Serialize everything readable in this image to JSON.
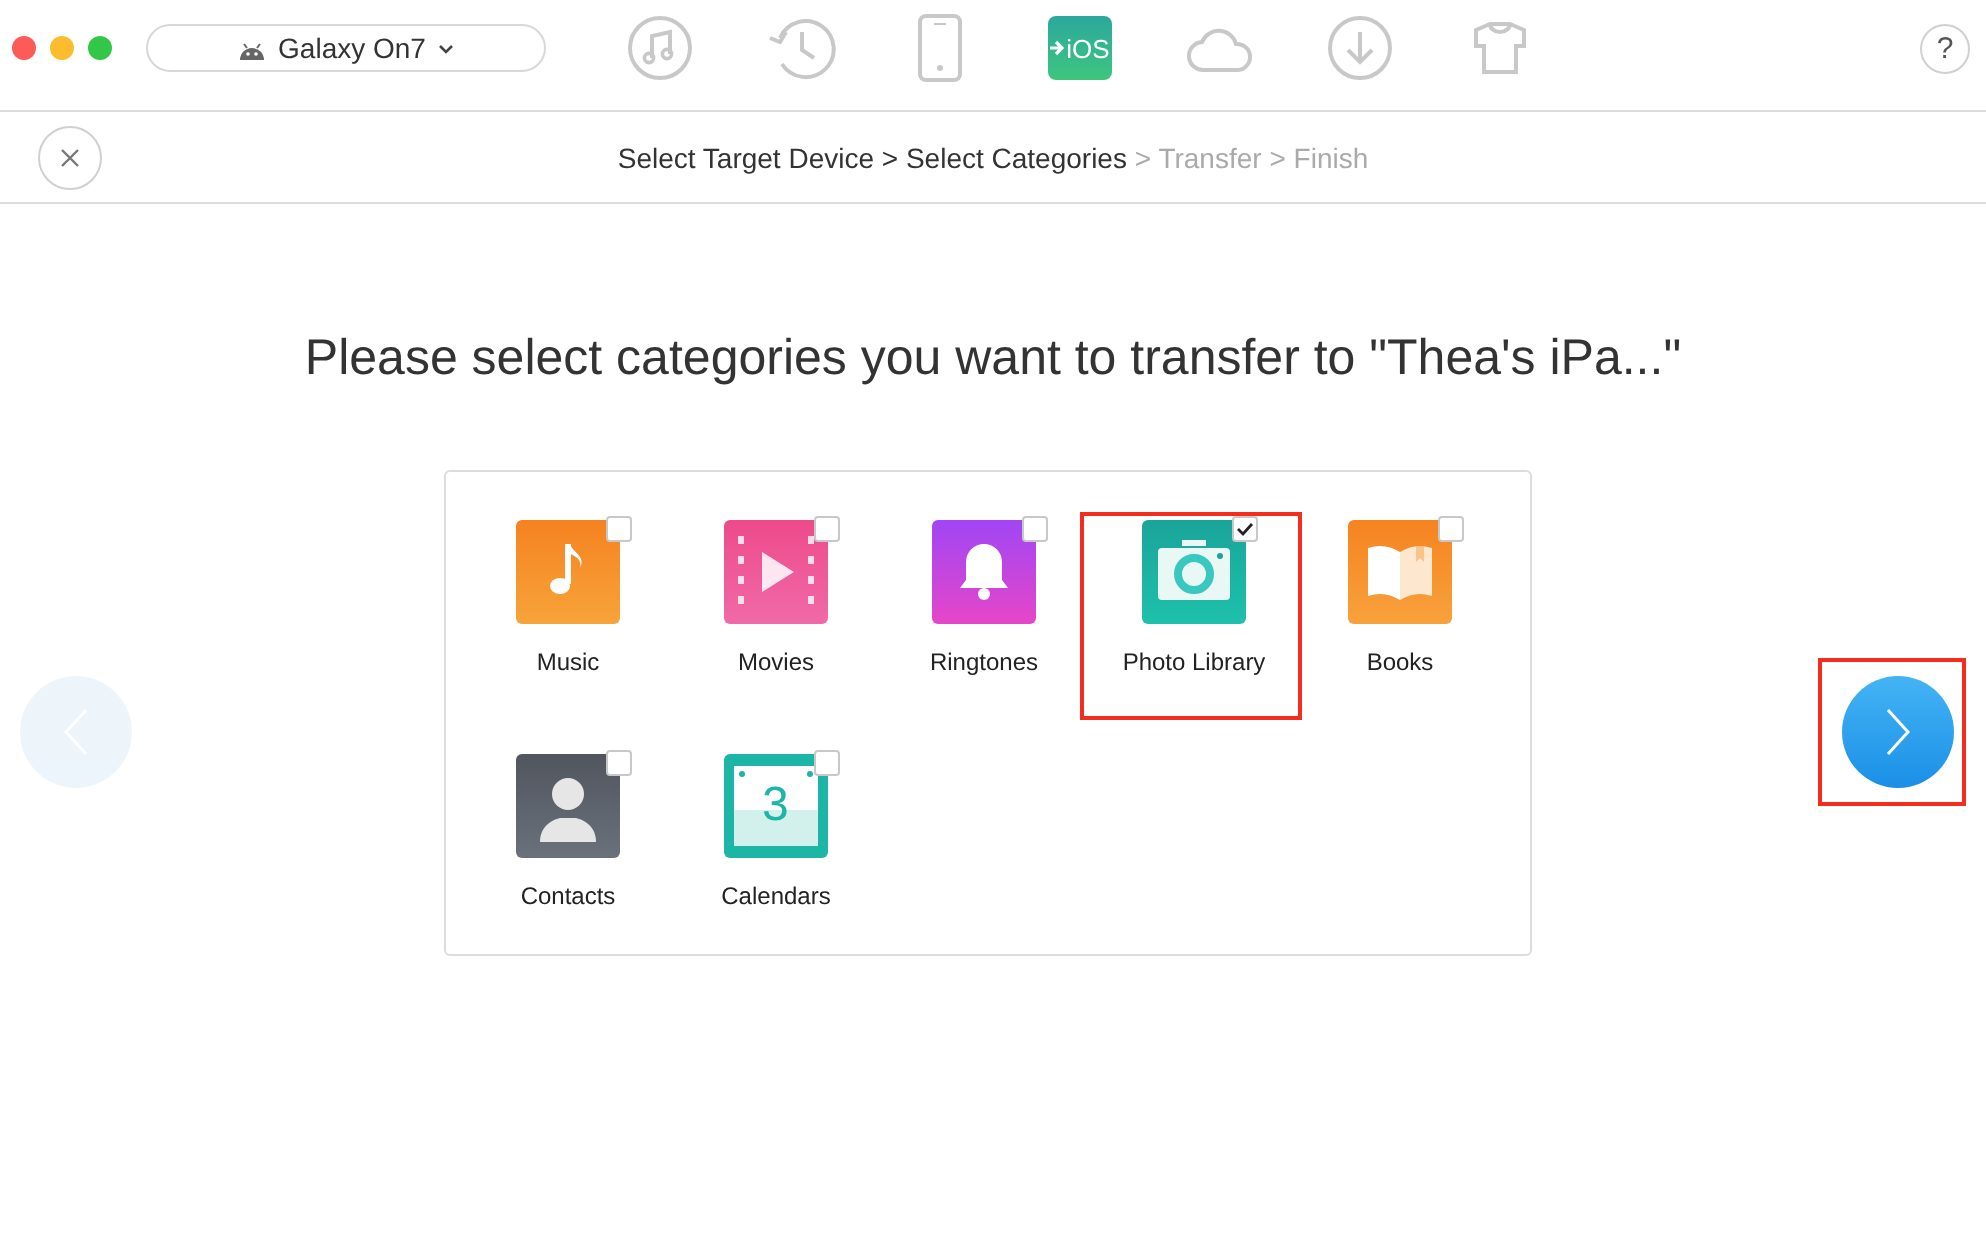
{
  "device_selector": {
    "label": "Galaxy On7"
  },
  "toolbar": [
    {
      "kind": "music",
      "selected": false
    },
    {
      "kind": "history",
      "selected": false
    },
    {
      "kind": "phone",
      "selected": false
    },
    {
      "kind": "ios",
      "label": "iOS",
      "selected": true
    },
    {
      "kind": "cloud",
      "selected": false
    },
    {
      "kind": "download",
      "selected": false
    },
    {
      "kind": "shirt",
      "selected": false
    }
  ],
  "help_button": {
    "label": "?"
  },
  "breadcrumb": {
    "separator": ">",
    "steps": [
      {
        "label": "Select Target Device",
        "reached": true
      },
      {
        "label": "Select Categories",
        "reached": true
      },
      {
        "label": "Transfer",
        "reached": false
      },
      {
        "label": "Finish",
        "reached": false
      }
    ]
  },
  "heading": "Please select categories you want to transfer to \"Thea's iPa...\"",
  "categories": [
    {
      "kind": "music",
      "label": "Music",
      "checked": false,
      "highlighted": false
    },
    {
      "kind": "movies",
      "label": "Movies",
      "checked": false,
      "highlighted": false
    },
    {
      "kind": "ringtones",
      "label": "Ringtones",
      "checked": false,
      "highlighted": false
    },
    {
      "kind": "photos",
      "label": "Photo Library",
      "checked": true,
      "highlighted": true
    },
    {
      "kind": "books",
      "label": "Books",
      "checked": false,
      "highlighted": false
    },
    {
      "kind": "contacts",
      "label": "Contacts",
      "checked": false,
      "highlighted": false
    },
    {
      "kind": "calendars",
      "label": "Calendars",
      "checked": false,
      "highlighted": false,
      "icon_text": "3"
    }
  ],
  "previous_button": {
    "disabled": true
  },
  "next_button": {
    "disabled": false,
    "highlighted": true
  }
}
